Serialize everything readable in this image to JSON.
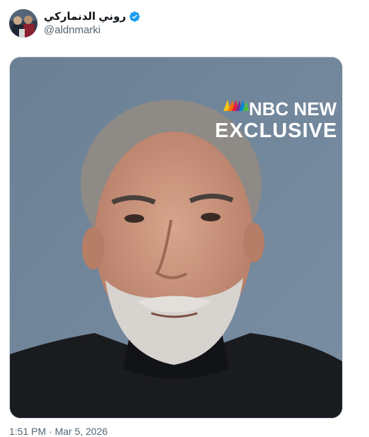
{
  "tweet": {
    "author": {
      "display_name": "روني الدنماركي",
      "handle": "@aldnmarki",
      "verified": true,
      "avatar_icon": "avatar-photo"
    },
    "media": {
      "kind": "video-thumbnail",
      "overlay_logo_line1": "NBC NEW",
      "overlay_logo_line2": "EXCLUSIVE",
      "icon": "nbc-peacock-icon"
    },
    "timestamp": "1:51 PM · Mar 5, 2026"
  },
  "colors": {
    "verified_badge": "#1d9bf0",
    "handle_text": "#536471",
    "media_border": "#cfd9de",
    "background": "#ffffff"
  }
}
